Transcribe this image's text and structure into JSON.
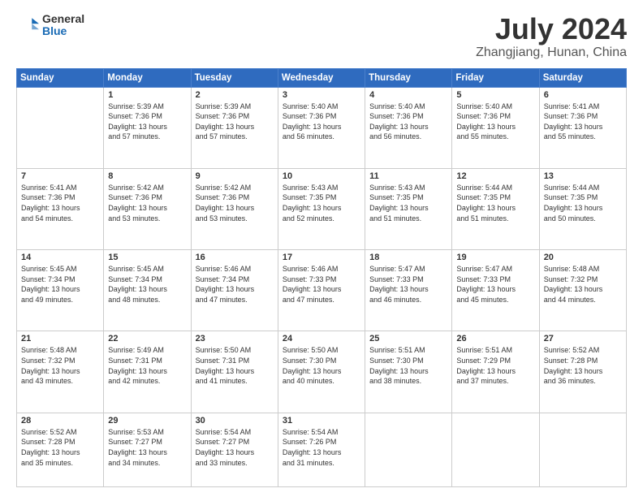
{
  "logo": {
    "general": "General",
    "blue": "Blue"
  },
  "title": {
    "month_year": "July 2024",
    "location": "Zhangjiang, Hunan, China"
  },
  "headers": [
    "Sunday",
    "Monday",
    "Tuesday",
    "Wednesday",
    "Thursday",
    "Friday",
    "Saturday"
  ],
  "weeks": [
    [
      {
        "day": "",
        "info": ""
      },
      {
        "day": "1",
        "info": "Sunrise: 5:39 AM\nSunset: 7:36 PM\nDaylight: 13 hours\nand 57 minutes."
      },
      {
        "day": "2",
        "info": "Sunrise: 5:39 AM\nSunset: 7:36 PM\nDaylight: 13 hours\nand 57 minutes."
      },
      {
        "day": "3",
        "info": "Sunrise: 5:40 AM\nSunset: 7:36 PM\nDaylight: 13 hours\nand 56 minutes."
      },
      {
        "day": "4",
        "info": "Sunrise: 5:40 AM\nSunset: 7:36 PM\nDaylight: 13 hours\nand 56 minutes."
      },
      {
        "day": "5",
        "info": "Sunrise: 5:40 AM\nSunset: 7:36 PM\nDaylight: 13 hours\nand 55 minutes."
      },
      {
        "day": "6",
        "info": "Sunrise: 5:41 AM\nSunset: 7:36 PM\nDaylight: 13 hours\nand 55 minutes."
      }
    ],
    [
      {
        "day": "7",
        "info": "Sunrise: 5:41 AM\nSunset: 7:36 PM\nDaylight: 13 hours\nand 54 minutes."
      },
      {
        "day": "8",
        "info": "Sunrise: 5:42 AM\nSunset: 7:36 PM\nDaylight: 13 hours\nand 53 minutes."
      },
      {
        "day": "9",
        "info": "Sunrise: 5:42 AM\nSunset: 7:36 PM\nDaylight: 13 hours\nand 53 minutes."
      },
      {
        "day": "10",
        "info": "Sunrise: 5:43 AM\nSunset: 7:35 PM\nDaylight: 13 hours\nand 52 minutes."
      },
      {
        "day": "11",
        "info": "Sunrise: 5:43 AM\nSunset: 7:35 PM\nDaylight: 13 hours\nand 51 minutes."
      },
      {
        "day": "12",
        "info": "Sunrise: 5:44 AM\nSunset: 7:35 PM\nDaylight: 13 hours\nand 51 minutes."
      },
      {
        "day": "13",
        "info": "Sunrise: 5:44 AM\nSunset: 7:35 PM\nDaylight: 13 hours\nand 50 minutes."
      }
    ],
    [
      {
        "day": "14",
        "info": "Sunrise: 5:45 AM\nSunset: 7:34 PM\nDaylight: 13 hours\nand 49 minutes."
      },
      {
        "day": "15",
        "info": "Sunrise: 5:45 AM\nSunset: 7:34 PM\nDaylight: 13 hours\nand 48 minutes."
      },
      {
        "day": "16",
        "info": "Sunrise: 5:46 AM\nSunset: 7:34 PM\nDaylight: 13 hours\nand 47 minutes."
      },
      {
        "day": "17",
        "info": "Sunrise: 5:46 AM\nSunset: 7:33 PM\nDaylight: 13 hours\nand 47 minutes."
      },
      {
        "day": "18",
        "info": "Sunrise: 5:47 AM\nSunset: 7:33 PM\nDaylight: 13 hours\nand 46 minutes."
      },
      {
        "day": "19",
        "info": "Sunrise: 5:47 AM\nSunset: 7:33 PM\nDaylight: 13 hours\nand 45 minutes."
      },
      {
        "day": "20",
        "info": "Sunrise: 5:48 AM\nSunset: 7:32 PM\nDaylight: 13 hours\nand 44 minutes."
      }
    ],
    [
      {
        "day": "21",
        "info": "Sunrise: 5:48 AM\nSunset: 7:32 PM\nDaylight: 13 hours\nand 43 minutes."
      },
      {
        "day": "22",
        "info": "Sunrise: 5:49 AM\nSunset: 7:31 PM\nDaylight: 13 hours\nand 42 minutes."
      },
      {
        "day": "23",
        "info": "Sunrise: 5:50 AM\nSunset: 7:31 PM\nDaylight: 13 hours\nand 41 minutes."
      },
      {
        "day": "24",
        "info": "Sunrise: 5:50 AM\nSunset: 7:30 PM\nDaylight: 13 hours\nand 40 minutes."
      },
      {
        "day": "25",
        "info": "Sunrise: 5:51 AM\nSunset: 7:30 PM\nDaylight: 13 hours\nand 38 minutes."
      },
      {
        "day": "26",
        "info": "Sunrise: 5:51 AM\nSunset: 7:29 PM\nDaylight: 13 hours\nand 37 minutes."
      },
      {
        "day": "27",
        "info": "Sunrise: 5:52 AM\nSunset: 7:28 PM\nDaylight: 13 hours\nand 36 minutes."
      }
    ],
    [
      {
        "day": "28",
        "info": "Sunrise: 5:52 AM\nSunset: 7:28 PM\nDaylight: 13 hours\nand 35 minutes."
      },
      {
        "day": "29",
        "info": "Sunrise: 5:53 AM\nSunset: 7:27 PM\nDaylight: 13 hours\nand 34 minutes."
      },
      {
        "day": "30",
        "info": "Sunrise: 5:54 AM\nSunset: 7:27 PM\nDaylight: 13 hours\nand 33 minutes."
      },
      {
        "day": "31",
        "info": "Sunrise: 5:54 AM\nSunset: 7:26 PM\nDaylight: 13 hours\nand 31 minutes."
      },
      {
        "day": "",
        "info": ""
      },
      {
        "day": "",
        "info": ""
      },
      {
        "day": "",
        "info": ""
      }
    ]
  ]
}
